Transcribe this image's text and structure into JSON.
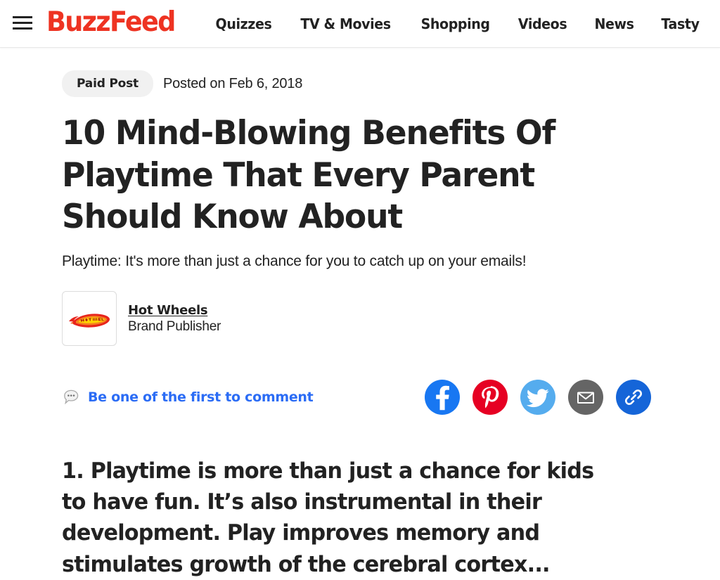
{
  "header": {
    "menu_icon": "hamburger-menu-icon",
    "logo_text": "BuzzFeed",
    "logo_color": "#ee3322",
    "nav": [
      {
        "label": "Quizzes"
      },
      {
        "label": "TV & Movies"
      },
      {
        "label": "Shopping"
      },
      {
        "label": "Videos"
      },
      {
        "label": "News"
      },
      {
        "label": "Tasty"
      }
    ]
  },
  "article": {
    "badge": "Paid Post",
    "posted": "Posted on Feb 6, 2018",
    "headline": "10 Mind-Blowing Benefits Of Playtime That Every Parent Should Know About",
    "dek": "Playtime: It's more than just a chance for you to catch up on your emails!",
    "byline": {
      "avatar_icon": "hot-wheels-logo",
      "name": "Hot Wheels",
      "role": "Brand Publisher"
    },
    "comment": {
      "icon": "comment-bubble-icon",
      "label": "Be one of the first to comment",
      "color": "#2b6cf5"
    },
    "share": [
      {
        "name": "facebook",
        "color": "#1877f2"
      },
      {
        "name": "pinterest",
        "color": "#e60023"
      },
      {
        "name": "twitter",
        "color": "#55acee"
      },
      {
        "name": "email",
        "color": "#656565"
      },
      {
        "name": "link",
        "color": "#1565d8"
      }
    ],
    "body_paragraph": "1. Playtime is more than just a chance for kids to have fun. It’s also instrumental in their development. Play improves memory and stimulates growth of the cerebral cortex..."
  }
}
